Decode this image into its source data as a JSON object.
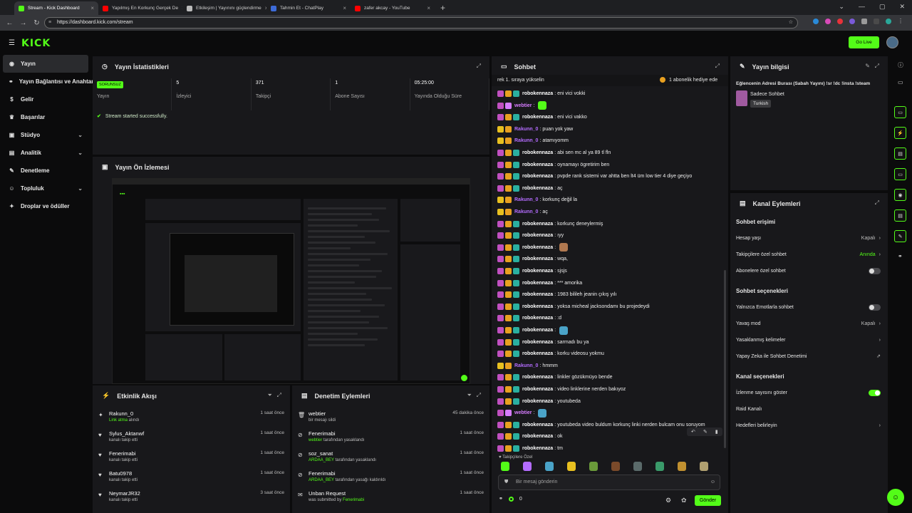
{
  "browser": {
    "tabs": [
      {
        "label": "Stream - Kick Dashboard",
        "color": "#53fc18",
        "active": true
      },
      {
        "label": "Yapılmış En Korkunç Gerçek De",
        "color": "#ff0000",
        "active": false
      },
      {
        "label": "Etkileşim | Yayınını güçlendirme",
        "color": "#bbbbbb",
        "active": false
      },
      {
        "label": "Tahmin Et - ChatPlay",
        "color": "#3d6bd8",
        "active": false
      },
      {
        "label": "zafer akcay - YouTube",
        "color": "#ff0000",
        "active": false
      }
    ],
    "new_tab": "+",
    "url": "https://dashboard.kick.com/stream"
  },
  "app": {
    "logo": "KICK",
    "go_live": "Go Live"
  },
  "sidebar": {
    "items": [
      {
        "label": "Yayın",
        "icon": "broadcast-icon",
        "glyph": "◉",
        "chevron": false
      },
      {
        "label": "Yayın Bağlantısı ve Anahtarı",
        "icon": "link-icon",
        "glyph": "⚭",
        "chevron": false
      },
      {
        "label": "Gelir",
        "icon": "dollar-icon",
        "glyph": "$",
        "chevron": false
      },
      {
        "label": "Başarılar",
        "icon": "trophy-icon",
        "glyph": "♛",
        "chevron": false
      },
      {
        "label": "Stüdyo",
        "icon": "studio-icon",
        "glyph": "▣",
        "chevron": true
      },
      {
        "label": "Analitik",
        "icon": "chart-icon",
        "glyph": "▤",
        "chevron": true
      },
      {
        "label": "Denetleme",
        "icon": "wrench-icon",
        "glyph": "✎",
        "chevron": false
      },
      {
        "label": "Topluluk",
        "icon": "users-icon",
        "glyph": "☺",
        "chevron": true
      },
      {
        "label": "Droplar ve ödüller",
        "icon": "gift-icon",
        "glyph": "✦",
        "chevron": false
      }
    ]
  },
  "stats_panel": {
    "title": "Yayın İstatistikleri",
    "badge": "SORUNSUZ",
    "stats": [
      {
        "value": "",
        "label": "Yayın"
      },
      {
        "value": "5",
        "label": "İzleyici"
      },
      {
        "value": "371",
        "label": "Takipçi"
      },
      {
        "value": "1",
        "label": "Abone Sayısı"
      },
      {
        "value": "05:25:00",
        "label": "Yayında Olduğu Süre"
      }
    ],
    "message": "Stream started successfully."
  },
  "preview_panel": {
    "title": "Yayın Ön İzlemesi"
  },
  "activity_panel": {
    "title": "Etkinlik Akışı",
    "rows": [
      {
        "icon": "gift-icon",
        "glyph": "✦",
        "name": "Rakunn_0",
        "accent": "Link atma",
        "sub": " alındı",
        "time": "1 saat önce"
      },
      {
        "icon": "heart-icon",
        "glyph": "♥",
        "name": "Sylus_Aktanwf",
        "accent": "",
        "sub": "kanalı takip etti",
        "time": "1 saat önce"
      },
      {
        "icon": "heart-icon",
        "glyph": "♥",
        "name": "Fenerimabi",
        "accent": "",
        "sub": "kanalı takip etti",
        "time": "1 saat önce"
      },
      {
        "icon": "heart-icon",
        "glyph": "♥",
        "name": "Batu0978",
        "accent": "",
        "sub": "kanalı takip etti",
        "time": "1 saat önce"
      },
      {
        "icon": "heart-icon",
        "glyph": "♥",
        "name": "NeymarJR32",
        "accent": "",
        "sub": "kanalı takip etti",
        "time": "3 saat önce"
      }
    ]
  },
  "moderation_panel": {
    "title": "Denetim Eylemleri",
    "rows": [
      {
        "icon": "trash-icon",
        "glyph": "🗑",
        "name": "webtier",
        "accent": "",
        "sub": "bir mesajı sildi",
        "time": "45 dakika önce"
      },
      {
        "icon": "ban-icon",
        "glyph": "⊘",
        "name": "Fenerimabi",
        "accent": "webtier",
        "sub": " tarafından yasaklandı",
        "time": "1 saat önce"
      },
      {
        "icon": "ban-icon",
        "glyph": "⊘",
        "name": "soz_sanat",
        "accent": "ARDAA_BEY",
        "sub": " tarafından yasaklandı",
        "time": "1 saat önce"
      },
      {
        "icon": "unban-icon",
        "glyph": "⊘",
        "name": "Fenerimabi",
        "accent": "ARDAA_BEY",
        "sub": " tarafından yasağı kaldırıldı",
        "time": "1 saat önce"
      },
      {
        "icon": "request-icon",
        "glyph": "✉",
        "name": "Unban Request",
        "accent": "",
        "sub": "was submitted by ",
        "accent2": "Fenerimabi",
        "time": "1 saat önce"
      }
    ]
  },
  "chat_panel": {
    "title": "Sohbet",
    "banner_left": "rek 1. sıraya yükselin",
    "banner_right": "1 abonelik hediye ede",
    "messages": [
      {
        "user": "robokennaza",
        "color": "#ffffff",
        "text": "eni vici vokki"
      },
      {
        "user": "webtier",
        "color": "#d77cff",
        "text": "",
        "emote": "#53fc18"
      },
      {
        "user": "robokennaza",
        "color": "#ffffff",
        "text": "eni vici vakko"
      },
      {
        "user": "Rakunn_0",
        "color": "#b46cff",
        "text": "puan yok yaw"
      },
      {
        "user": "Rakunn_0",
        "color": "#b46cff",
        "text": "atamıyomm"
      },
      {
        "user": "robokennaza",
        "color": "#ffffff",
        "text": "abi sen mc al ya 89 tl fln"
      },
      {
        "user": "robokennaza",
        "color": "#ffffff",
        "text": "oynamayı ögretirim ben"
      },
      {
        "user": "robokennaza",
        "color": "#ffffff",
        "text": "pvpde rank sistemi var ahtta ben lt4 üm low tier 4 diye geçiyo"
      },
      {
        "user": "robokennaza",
        "color": "#ffffff",
        "text": "aç"
      },
      {
        "user": "Rakunn_0",
        "color": "#b46cff",
        "text": "korkunç değil la"
      },
      {
        "user": "Rakunn_0",
        "color": "#b46cff",
        "text": "aç"
      },
      {
        "user": "robokennaza",
        "color": "#ffffff",
        "text": "korkunç deneylermiş"
      },
      {
        "user": "robokennaza",
        "color": "#ffffff",
        "text": "ıyy"
      },
      {
        "user": "robokennaza",
        "color": "#ffffff",
        "text": "",
        "emote": "#b07850"
      },
      {
        "user": "robokennaza",
        "color": "#ffffff",
        "text": "wqa,"
      },
      {
        "user": "robokennaza",
        "color": "#ffffff",
        "text": "sjsjs"
      },
      {
        "user": "robokennaza",
        "color": "#ffffff",
        "text": "*** amorika"
      },
      {
        "user": "robokennaza",
        "color": "#ffffff",
        "text": "1983 bilileh jeanin çıkış yılı"
      },
      {
        "user": "robokennaza",
        "color": "#ffffff",
        "text": "yoksa micheal jacksondamı bu projedeydi"
      },
      {
        "user": "robokennaza",
        "color": "#ffffff",
        "text": ":d"
      },
      {
        "user": "robokennaza",
        "color": "#ffffff",
        "text": "",
        "emote": "#4aa3c8"
      },
      {
        "user": "robokennaza",
        "color": "#ffffff",
        "text": "sarmadı bu ya"
      },
      {
        "user": "robokennaza",
        "color": "#ffffff",
        "text": "korku videosu yokmu"
      },
      {
        "user": "Rakunn_0",
        "color": "#b46cff",
        "text": "hmmm"
      },
      {
        "user": "robokennaza",
        "color": "#ffffff",
        "text": "linkler gözükmüyo bende"
      },
      {
        "user": "robokennaza",
        "color": "#ffffff",
        "text": "video linklerine nerden bakıyoz"
      },
      {
        "user": "robokennaza",
        "color": "#ffffff",
        "text": "youtubeda"
      },
      {
        "user": "webtier",
        "color": "#d77cff",
        "text": "",
        "emote": "#4aa3c8"
      },
      {
        "user": "robokennaza",
        "color": "#ffffff",
        "text": "youtubeda video buldum korkunç linki nerden bulcam onu soruyom"
      },
      {
        "user": "robokennaza",
        "color": "#ffffff",
        "text": "ok"
      },
      {
        "user": "robokennaza",
        "color": "#ffffff",
        "text": "tm"
      }
    ],
    "emote_section": "Takipçilere Özel",
    "emote_colors": [
      "#53fc18",
      "#b46cff",
      "#4aa3c8",
      "#e8c020",
      "#6a9a3a",
      "#7a4a2a",
      "#5a6a6a",
      "#3a9a6a",
      "#c09030",
      "#b0a070"
    ],
    "input_placeholder": "Bir mesaj gönderin",
    "viewer_count": "0",
    "send_label": "Gönder"
  },
  "stream_info_panel": {
    "title": "Yayın bilgisi",
    "stream_title": "Eğlencenin Adresi Burası (Sabah Yayını) !sr !dc !insta !steam",
    "category": "Sadece Sohbet",
    "language": "Turkish"
  },
  "channel_actions_panel": {
    "title": "Kanal Eylemleri",
    "sections": [
      {
        "heading": "Sohbet erişimi",
        "rows": [
          {
            "label": "Hesap yaşı",
            "value": "Kapalı",
            "type": "chevron",
            "accent": false
          },
          {
            "label": "Takipçilere özel sohbet",
            "value": "Anında",
            "type": "chevron",
            "accent": true
          },
          {
            "label": "Abonelere özel sohbet",
            "value": "",
            "type": "toggle",
            "on": false
          }
        ]
      },
      {
        "heading": "Sohbet seçenekleri",
        "rows": [
          {
            "label": "Yalnızca Emotlarla sohbet",
            "value": "",
            "type": "toggle",
            "on": false
          },
          {
            "label": "Yavaş mod",
            "value": "Kapalı",
            "type": "chevron",
            "accent": false
          },
          {
            "label": "Yasaklanmış kelimeler",
            "value": "",
            "type": "chevron",
            "accent": false
          },
          {
            "label": "Yapay Zeka ile Sohbet Denetimi",
            "value": "",
            "type": "external",
            "accent": false
          }
        ]
      },
      {
        "heading": "Kanal seçenekleri",
        "rows": [
          {
            "label": "İzlenme sayısını göster",
            "value": "",
            "type": "toggle",
            "on": true
          },
          {
            "label": "Raid Kanalı",
            "value": "",
            "type": "none",
            "accent": false
          },
          {
            "label": "Hedefleri belirleyin",
            "value": "",
            "type": "chevron",
            "accent": false
          }
        ]
      }
    ]
  },
  "right_rail": {
    "icons": [
      "chat-panel-icon",
      "activity-icon",
      "stats-icon",
      "chat-icon",
      "preview-icon",
      "moderation-icon",
      "wrench-icon"
    ]
  },
  "colors": {
    "accent": "#53fc18",
    "panel": "#18181b",
    "background": "#0b0b0c"
  }
}
